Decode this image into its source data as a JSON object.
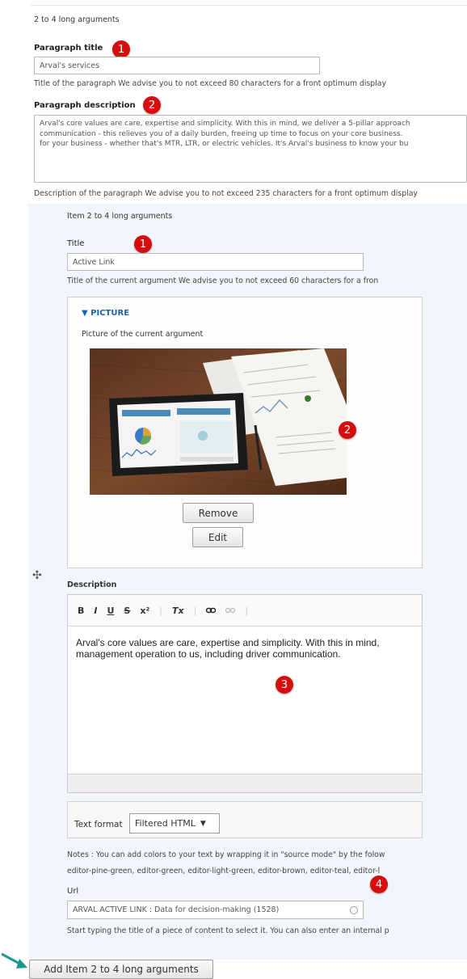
{
  "paragraph": {
    "header": "2 to 4 long arguments",
    "title_label": "Paragraph title",
    "title_value": "Arval's services",
    "title_help": "Title of the paragraph We advise you to not exceed 80 characters for a front optimum display",
    "desc_label": "Paragraph description",
    "desc_lines": [
      "Arval's core values are care, expertise and simplicity. With this in mind, we deliver a 5-pillar approach",
      "communication - this relieves you of a daily burden, freeing up time to focus on your core business.",
      "for your business - whether that's MTR, LTR, or electric vehicles. It's Arval's business to know your bu"
    ],
    "desc_help": "Description of the paragraph We advise you to not exceed 235 characters for a front optimum display"
  },
  "item": {
    "header": "Item 2 to 4 long arguments",
    "title_label": "Title",
    "title_value": "Active Link",
    "title_help": "Title of the current argument We advise you to not exceed 60 characters for a fron",
    "picture_legend": "▼ PICTURE",
    "picture_help": "Picture of the current argument",
    "remove_label": "Remove",
    "edit_label": "Edit",
    "description_label": "Description",
    "toolbar": [
      "B",
      "I",
      "U",
      "S",
      "x²",
      "Tx",
      "link",
      "unlink"
    ],
    "editor_lines": [
      "Arval's core values are care, expertise and simplicity. With this in mind,",
      "management operation to us, including driver communication."
    ],
    "text_format_label": "Text format",
    "text_format_value": "Filtered HTML",
    "notes_lines": [
      "Notes : You can add colors to your text by wrapping it in \"source mode\" by the folow",
      "editor-pine-green, editor-green, editor-light-green, editor-brown, editor-teal, editor-l"
    ],
    "url_label": "Url",
    "url_value": "ARVAL ACTIVE LINK : Data for decision-making (1528)",
    "url_help": "Start typing the title of a piece of content to select it. You can also enter an internal p",
    "add_button": "Add Item 2 to 4 long arguments"
  },
  "badges": {
    "para_title": "1",
    "para_desc": "2",
    "item_title": "1",
    "item_picture": "2",
    "item_desc": "3",
    "item_url": "4"
  },
  "colors": {
    "badge": "#d60d0d",
    "item_background": "#f1f6fc",
    "arrow": "#1a9a8a"
  }
}
